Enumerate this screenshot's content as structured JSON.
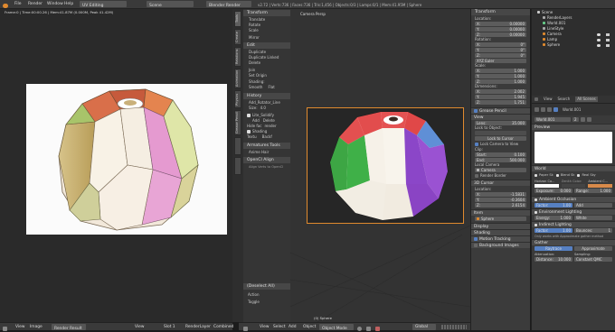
{
  "topbar": {
    "menus": [
      "File",
      "Render",
      "Window",
      "Help"
    ],
    "screen_layout": "UV Editing",
    "scene": "Scene",
    "engine": "Blender Render",
    "info": "v2.72 | Verts:736 | Faces:736 | Tris:1,456 | Objects:0/3 | Lamps:0/1 | Mem:41.95M | Sphere"
  },
  "image_editor": {
    "info": "Frame:0 | Time:00:00.26 | Mem:41.87M (0.000M, Peak 41.42M)",
    "menus": [
      "View",
      "Image"
    ],
    "image_name": "Render Result",
    "view": "View",
    "slot": "Slot 1",
    "layer": "RenderLayer",
    "pass": "Combined"
  },
  "tool_shelf": {
    "tabs": [
      "Tools",
      "Create",
      "Relations",
      "Animation",
      "Physics",
      "Grease Pencil"
    ],
    "transform_header": "Transform",
    "transform_items": [
      "Translate",
      "Rotate",
      "Scale",
      "Mirror"
    ],
    "edit_header": "Edit",
    "edit_items": [
      "Duplicate",
      "Duplicate Linked",
      "Delete",
      "Join",
      "Set Origin"
    ],
    "shading_label": "Shading:",
    "smooth": "Smooth",
    "flat": "Flat",
    "history_header": "History",
    "operator": "Add_Rotator_Line",
    "size_label": "Size:",
    "size_value": "4.0",
    "lite_header": "Lite_Solidify",
    "add": "Add",
    "delete": "Delete",
    "hide_faces": "Hide fac",
    "render": "render",
    "shading2": "Shading",
    "textu": "Textu",
    "backf": "Backf",
    "armature_tools": "Armatures Tools",
    "anime_hair": "Anime Hair",
    "opencl": "OpenCl Align",
    "align_note": "Align Verts to OpenCl",
    "redo_header": "(Deselect All)",
    "action": "Action",
    "toggle": "Toggle"
  },
  "viewport": {
    "label": "Camera Persp",
    "object_label": "(0) Sphere",
    "menus": [
      "View",
      "Select",
      "Add",
      "Object"
    ],
    "mode": "Object Mode",
    "pivot": "Global"
  },
  "n_panel": {
    "transform_header": "Transform",
    "location_label": "Location:",
    "location": [
      "X:",
      "Y:",
      "Z:"
    ],
    "location_values": [
      "0.00000",
      "0.00000",
      "0.00000"
    ],
    "rotation_label": "Rotation:",
    "rotation_values": [
      "0°",
      "0°",
      "0°"
    ],
    "rot_mode": "XYZ Euler",
    "scale_label": "Scale:",
    "scale_values": [
      "1.000",
      "1.000",
      "1.000"
    ],
    "dimensions_label": "Dimensions:",
    "dimensions_values": [
      "2.002",
      "1.945",
      "1.751"
    ],
    "grease_header": "Grease Pencil",
    "view_header": "View",
    "lens_label": "Lens:",
    "lens_value": "35.000",
    "lock_to_object": "Lock to Object:",
    "lock_cursor": "Lock to Cursor",
    "lock_camera": "Lock Camera to View",
    "clip_label": "Clip:",
    "start_label": "Start:",
    "start_value": "0.100",
    "end_label": "End:",
    "end_value": "500.000",
    "local_camera": "Local Camera",
    "camera_name": "Camera",
    "render_border": "Render Border",
    "cursor_header": "3D Cursor",
    "cursor_location_label": "Location:",
    "cursor_values": [
      "-1.5831",
      "-0.3604",
      "2.6154"
    ],
    "item_header": "Item",
    "item_name": "Sphere",
    "display_header": "Display",
    "shading_header": "Shading",
    "motion_tracking": "Motion Tracking",
    "background_images": "Background Images"
  },
  "outliner": {
    "items": [
      "Scene",
      "RenderLayers",
      "World.001",
      "LineStyle",
      "Camera",
      "Lamp",
      "Sphere"
    ]
  },
  "properties": {
    "tabs": [
      "View",
      "Search",
      "All Scenes"
    ],
    "world_name": "World.001",
    "world_datablock": "World.001",
    "users": "2",
    "preview_header": "Preview",
    "world_header": "World",
    "paper_sky": "Paper Sk",
    "blend_sky": "Blend Sk",
    "real_sky": "Real Sky",
    "horizon_color": "Horizon Co...",
    "zenith_color": "Zenith Color:",
    "ambient_color": "Ambient C...",
    "exposure_label": "Exposure:",
    "exposure_value": "0.000",
    "range_label": "Range:",
    "range_value": "1.000",
    "ao_header": "Ambient Occlusion",
    "factor_label": "Factor:",
    "factor_value": "1.00",
    "add": "Add",
    "env_header": "Environment Lighting",
    "energy_label": "Energy:",
    "energy_value": "1.000",
    "white": "White",
    "indirect_header": "Indirect Lighting",
    "bounces_label": "Bounces:",
    "bounces_value": "1",
    "indirect_note": "Only works with Approximate gather method",
    "gather_header": "Gather",
    "raytrace": "Raytrace",
    "approximate": "Approximate",
    "attenuation": "Attenuation:",
    "sampling": "Sampling:",
    "distance_label": "Distance:",
    "distance_value": "10.000",
    "sampling_method": "Constant QMC"
  },
  "colors": {
    "accent": "#5680c2",
    "selection": "#e08a2e",
    "ball_red": "#e04a4a",
    "ball_green": "#3fa845",
    "ball_purple": "#8a45c8",
    "ball_white": "#f4efe6"
  }
}
